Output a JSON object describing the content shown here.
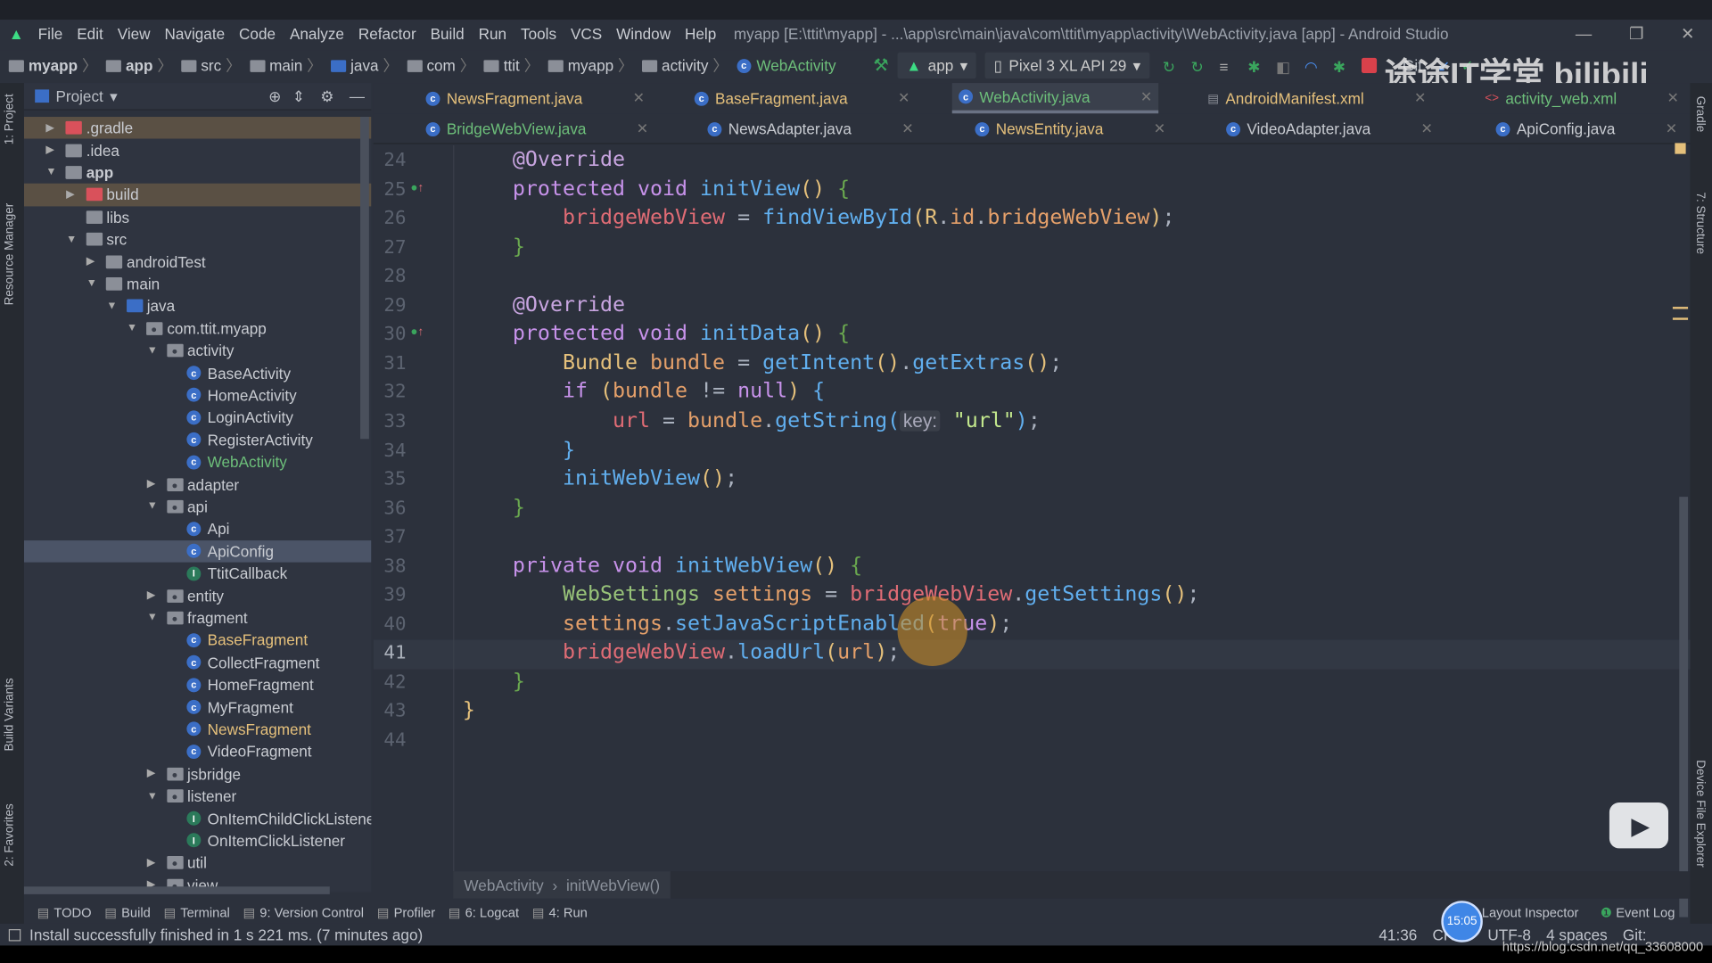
{
  "menu": {
    "items": [
      "File",
      "Edit",
      "View",
      "Navigate",
      "Code",
      "Analyze",
      "Refactor",
      "Build",
      "Run",
      "Tools",
      "VCS",
      "Window",
      "Help"
    ],
    "title": "myapp [E:\\ttit\\myapp] - ...\\app\\src\\main\\java\\com\\ttit\\myapp\\activity\\WebActivity.java [app] - Android Studio"
  },
  "breadcrumb": [
    "myapp",
    "app",
    "src",
    "main",
    "java",
    "com",
    "ttit",
    "myapp",
    "activity",
    "WebActivity"
  ],
  "toolbar": {
    "run_config": "app",
    "device": "Pixel 3 XL API 29",
    "git_label": "Git:"
  },
  "watermark": "途途IT学堂 bilibili",
  "project_panel": {
    "title": "Project",
    "side_tabs": [
      "1: Project",
      "Resource Manager",
      "Build Variants",
      "2: Favorites"
    ]
  },
  "right_tabs": [
    "Gradle",
    "7: Structure",
    "Device File Explorer"
  ],
  "tree": [
    {
      "label": ".gradle",
      "level": 0,
      "arrow": "closed",
      "icon": "folder-red",
      "hl": true
    },
    {
      "label": ".idea",
      "level": 0,
      "arrow": "closed",
      "icon": "folder"
    },
    {
      "label": "app",
      "level": 0,
      "arrow": "open",
      "icon": "module",
      "bold": true
    },
    {
      "label": "build",
      "level": 1,
      "arrow": "closed",
      "icon": "folder-red",
      "hl": true
    },
    {
      "label": "libs",
      "level": 1,
      "arrow": "none",
      "icon": "folder"
    },
    {
      "label": "src",
      "level": 1,
      "arrow": "open",
      "icon": "folder"
    },
    {
      "label": "androidTest",
      "level": 2,
      "arrow": "closed",
      "icon": "folder"
    },
    {
      "label": "main",
      "level": 2,
      "arrow": "open",
      "icon": "folder"
    },
    {
      "label": "java",
      "level": 3,
      "arrow": "open",
      "icon": "folder-blue"
    },
    {
      "label": "com.ttit.myapp",
      "level": 4,
      "arrow": "open",
      "icon": "package"
    },
    {
      "label": "activity",
      "level": 5,
      "arrow": "open",
      "icon": "package"
    },
    {
      "label": "BaseActivity",
      "level": 6,
      "arrow": "none",
      "icon": "class"
    },
    {
      "label": "HomeActivity",
      "level": 6,
      "arrow": "none",
      "icon": "class"
    },
    {
      "label": "LoginActivity",
      "level": 6,
      "arrow": "none",
      "icon": "class"
    },
    {
      "label": "RegisterActivity",
      "level": 6,
      "arrow": "none",
      "icon": "class"
    },
    {
      "label": "WebActivity",
      "level": 6,
      "arrow": "none",
      "icon": "class",
      "color": "#6dbf7a"
    },
    {
      "label": "adapter",
      "level": 5,
      "arrow": "closed",
      "icon": "package"
    },
    {
      "label": "api",
      "level": 5,
      "arrow": "open",
      "icon": "package"
    },
    {
      "label": "Api",
      "level": 6,
      "arrow": "none",
      "icon": "class"
    },
    {
      "label": "ApiConfig",
      "level": 6,
      "arrow": "none",
      "icon": "class",
      "selected": true
    },
    {
      "label": "TtitCallback",
      "level": 6,
      "arrow": "none",
      "icon": "interface"
    },
    {
      "label": "entity",
      "level": 5,
      "arrow": "closed",
      "icon": "package"
    },
    {
      "label": "fragment",
      "level": 5,
      "arrow": "open",
      "icon": "package"
    },
    {
      "label": "BaseFragment",
      "level": 6,
      "arrow": "none",
      "icon": "class",
      "color": "#e5c07b"
    },
    {
      "label": "CollectFragment",
      "level": 6,
      "arrow": "none",
      "icon": "class"
    },
    {
      "label": "HomeFragment",
      "level": 6,
      "arrow": "none",
      "icon": "class"
    },
    {
      "label": "MyFragment",
      "level": 6,
      "arrow": "none",
      "icon": "class"
    },
    {
      "label": "NewsFragment",
      "level": 6,
      "arrow": "none",
      "icon": "class",
      "color": "#e5c07b"
    },
    {
      "label": "VideoFragment",
      "level": 6,
      "arrow": "none",
      "icon": "class"
    },
    {
      "label": "jsbridge",
      "level": 5,
      "arrow": "closed",
      "icon": "package"
    },
    {
      "label": "listener",
      "level": 5,
      "arrow": "open",
      "icon": "package"
    },
    {
      "label": "OnItemChildClickListener",
      "level": 6,
      "arrow": "none",
      "icon": "interface"
    },
    {
      "label": "OnItemClickListener",
      "level": 6,
      "arrow": "none",
      "icon": "interface"
    },
    {
      "label": "util",
      "level": 5,
      "arrow": "closed",
      "icon": "package"
    },
    {
      "label": "view",
      "level": 5,
      "arrow": "closed",
      "icon": "package"
    }
  ],
  "tabs_row1": [
    {
      "label": "NewsFragment.java",
      "color": "#e5c07b",
      "icon": "class"
    },
    {
      "label": "BaseFragment.java",
      "color": "#e5c07b",
      "icon": "class"
    },
    {
      "label": "WebActivity.java",
      "color": "#6dbf7a",
      "icon": "class",
      "active": true
    },
    {
      "label": "AndroidManifest.xml",
      "color": "#e5c07b",
      "icon": "manifest"
    },
    {
      "label": "activity_web.xml",
      "color": "#6dbf7a",
      "icon": "xml"
    }
  ],
  "tabs_row2": [
    {
      "label": "BridgeWebView.java",
      "color": "#6dbf7a",
      "icon": "class"
    },
    {
      "label": "NewsAdapter.java",
      "color": "#c9ccd2",
      "icon": "class"
    },
    {
      "label": "NewsEntity.java",
      "color": "#e5c07b",
      "icon": "class"
    },
    {
      "label": "VideoAdapter.java",
      "color": "#c9ccd2",
      "icon": "class"
    },
    {
      "label": "ApiConfig.java",
      "color": "#c9ccd2",
      "icon": "class"
    }
  ],
  "code": {
    "first_line": 24,
    "current_line": 41,
    "lines": [
      [
        [
          "        ",
          "p"
        ],
        [
          "@Override",
          "a"
        ]
      ],
      [
        [
          "        ",
          "p"
        ],
        [
          "protected ",
          "k"
        ],
        [
          "void ",
          "k"
        ],
        [
          "initView",
          "m"
        ],
        [
          "()",
          "y"
        ],
        [
          " {",
          "gr"
        ]
      ],
      [
        [
          "            ",
          "p"
        ],
        [
          "bridgeWebView",
          "f"
        ],
        [
          " = ",
          "p"
        ],
        [
          "findViewById",
          "m"
        ],
        [
          "(",
          "y"
        ],
        [
          "R",
          "c"
        ],
        [
          ".",
          "p"
        ],
        [
          "id",
          "v"
        ],
        [
          ".",
          "p"
        ],
        [
          "bridgeWebView",
          "v"
        ],
        [
          ")",
          "y"
        ],
        [
          ";",
          "p"
        ]
      ],
      [
        [
          "        ",
          "p"
        ],
        [
          "}",
          "gr"
        ]
      ],
      [],
      [
        [
          "        ",
          "p"
        ],
        [
          "@Override",
          "a"
        ]
      ],
      [
        [
          "        ",
          "p"
        ],
        [
          "protected ",
          "k"
        ],
        [
          "void ",
          "k"
        ],
        [
          "initData",
          "m"
        ],
        [
          "()",
          "y"
        ],
        [
          " {",
          "gr"
        ]
      ],
      [
        [
          "            ",
          "p"
        ],
        [
          "Bundle ",
          "c"
        ],
        [
          "bundle",
          "v"
        ],
        [
          " = ",
          "p"
        ],
        [
          "getIntent",
          "m"
        ],
        [
          "()",
          "y"
        ],
        [
          ".",
          "p"
        ],
        [
          "getExtras",
          "m"
        ],
        [
          "()",
          "y"
        ],
        [
          ";",
          "p"
        ]
      ],
      [
        [
          "            ",
          "p"
        ],
        [
          "if ",
          "k"
        ],
        [
          "(",
          "y"
        ],
        [
          "bundle",
          "v"
        ],
        [
          " != ",
          "p"
        ],
        [
          "null",
          "k"
        ],
        [
          ")",
          "y"
        ],
        [
          " {",
          "b"
        ]
      ],
      [
        [
          "                ",
          "p"
        ],
        [
          "url",
          "f"
        ],
        [
          " = ",
          "p"
        ],
        [
          "bundle",
          "v"
        ],
        [
          ".",
          "p"
        ],
        [
          "getString",
          "m"
        ],
        [
          "(",
          "b"
        ],
        [
          "key:",
          "hint"
        ],
        [
          " \"url\"",
          "s"
        ],
        [
          ")",
          "b"
        ],
        [
          ";",
          "p"
        ]
      ],
      [
        [
          "            ",
          "p"
        ],
        [
          "}",
          "b"
        ]
      ],
      [
        [
          "            ",
          "p"
        ],
        [
          "initWebView",
          "m"
        ],
        [
          "()",
          "y"
        ],
        [
          ";",
          "p"
        ]
      ],
      [
        [
          "        ",
          "p"
        ],
        [
          "}",
          "gr"
        ]
      ],
      [],
      [
        [
          "        ",
          "p"
        ],
        [
          "private ",
          "k"
        ],
        [
          "void ",
          "k"
        ],
        [
          "initWebView",
          "m"
        ],
        [
          "()",
          "y"
        ],
        [
          " {",
          "gr"
        ]
      ],
      [
        [
          "            ",
          "p"
        ],
        [
          "WebSettings ",
          "g"
        ],
        [
          "settings",
          "v"
        ],
        [
          " = ",
          "p"
        ],
        [
          "bridgeWebView",
          "f"
        ],
        [
          ".",
          "p"
        ],
        [
          "getSettings",
          "m"
        ],
        [
          "()",
          "y"
        ],
        [
          ";",
          "p"
        ]
      ],
      [
        [
          "            ",
          "p"
        ],
        [
          "settings",
          "v"
        ],
        [
          ".",
          "p"
        ],
        [
          "setJavaScriptEnabled",
          "m"
        ],
        [
          "(",
          "y"
        ],
        [
          "true",
          "k"
        ],
        [
          ")",
          "y"
        ],
        [
          ";",
          "p"
        ]
      ],
      [
        [
          "            ",
          "p"
        ],
        [
          "bridgeWebView",
          "f"
        ],
        [
          ".",
          "p"
        ],
        [
          "loadUrl",
          "m"
        ],
        [
          "(",
          "y"
        ],
        [
          "url",
          "v"
        ],
        [
          ")",
          "y"
        ],
        [
          ";",
          "p"
        ]
      ],
      [
        [
          "        ",
          "p"
        ],
        [
          "}",
          "gr"
        ]
      ],
      [
        [
          "    ",
          "p"
        ],
        [
          "}",
          "y"
        ]
      ],
      []
    ]
  },
  "editor_breadcrumb": [
    "WebActivity",
    "initWebView()"
  ],
  "tool_windows": [
    "TODO",
    "Build",
    "Terminal",
    "9: Version Control",
    "Profiler",
    "6: Logcat",
    "4: Run"
  ],
  "right_tool_windows": [
    "Layout Inspector",
    "Event Log"
  ],
  "status": {
    "message": "Install successfully finished in 1 s 221 ms. (7 minutes ago)",
    "position": "41:36",
    "line_sep": "CRLF",
    "encoding": "UTF-8",
    "indent": "4 spaces",
    "git": "Git:",
    "clock": "15:05",
    "url_watermark": "https://blog.csdn.net/qq_33608000"
  }
}
